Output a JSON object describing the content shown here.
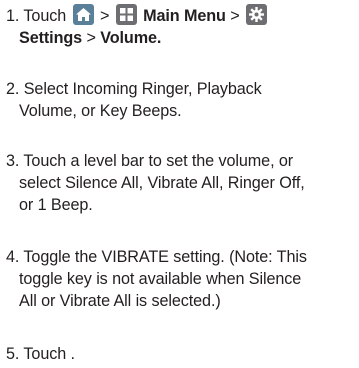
{
  "steps": [
    {
      "number": "1.",
      "touch": "Touch",
      "sep1": ">",
      "main_menu": "Main Menu",
      "sep2": ">",
      "settings": "Settings",
      "sep3": ">",
      "volume": "Volume."
    },
    {
      "number": "2.",
      "line1": "Select Incoming Ringer, Playback",
      "line2": "Volume, or Key Beeps."
    },
    {
      "number": "3.",
      "line1": "Touch a level bar to set the volume, or",
      "line2": "select Silence All, Vibrate All, Ringer Off,",
      "line3": "or 1 Beep."
    },
    {
      "number": "4.",
      "line1": "Toggle the VIBRATE setting. (Note: This",
      "line2": "toggle key is not available when Silence",
      "line3": "All or Vibrate All is selected.)"
    },
    {
      "number": "5.",
      "line1": "Touch ."
    }
  ],
  "icons": {
    "home": "home-icon",
    "menu": "main-menu-grid-icon",
    "settings": "settings-gear-icon"
  }
}
